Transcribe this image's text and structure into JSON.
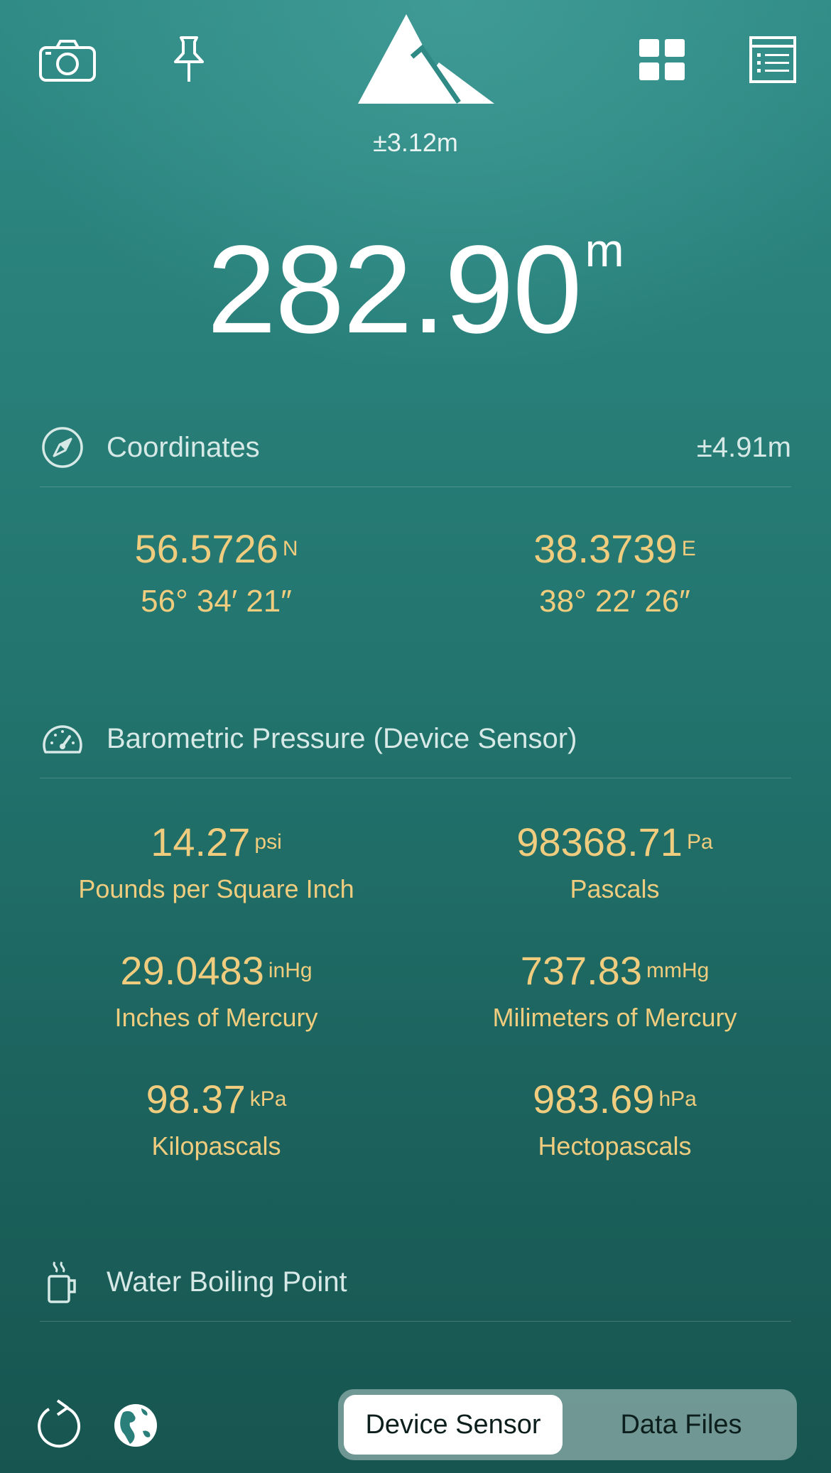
{
  "header": {
    "accuracy": "±3.12m",
    "icons": [
      "camera-icon",
      "pin-icon",
      "mountain-icon",
      "grid-icon",
      "list-icon"
    ]
  },
  "altitude": {
    "value": "282.90",
    "unit": "m"
  },
  "coordinates": {
    "title": "Coordinates",
    "accuracy": "±4.91m",
    "lat": {
      "decimal": "56.5726",
      "hemisphere": "N",
      "dms": "56° 34′ 21″"
    },
    "lon": {
      "decimal": "38.3739",
      "hemisphere": "E",
      "dms": "38° 22′ 26″"
    }
  },
  "pressure": {
    "title": "Barometric Pressure (Device Sensor)",
    "items": [
      {
        "value": "14.27",
        "unit": "psi",
        "label": "Pounds per Square Inch"
      },
      {
        "value": "98368.71",
        "unit": "Pa",
        "label": "Pascals"
      },
      {
        "value": "29.0483",
        "unit": "inHg",
        "label": "Inches of Mercury"
      },
      {
        "value": "737.83",
        "unit": "mmHg",
        "label": "Milimeters of Mercury"
      },
      {
        "value": "98.37",
        "unit": "kPa",
        "label": "Kilopascals"
      },
      {
        "value": "983.69",
        "unit": "hPa",
        "label": "Hectopascals"
      }
    ]
  },
  "boiling": {
    "title": "Water Boiling Point"
  },
  "footer": {
    "segments": [
      "Device Sensor",
      "Data Files"
    ],
    "selected": "Device Sensor"
  },
  "colors": {
    "value_gold": "#efcc7e",
    "background": "#237570"
  }
}
